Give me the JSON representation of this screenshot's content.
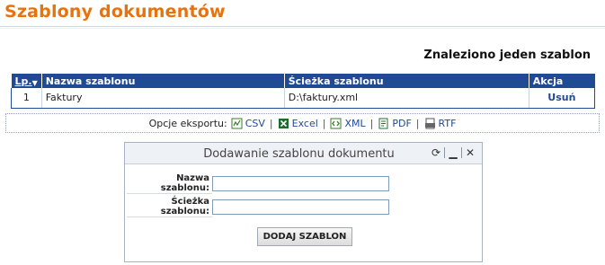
{
  "page": {
    "title": "Szablony dokumentów"
  },
  "results": {
    "found_text": "Znaleziono jeden szablon"
  },
  "table": {
    "columns": [
      "Lp.",
      "Nazwa szablonu",
      "Ścieżka szablonu",
      "Akcja"
    ],
    "rows": [
      {
        "lp": "1",
        "name": "Faktury",
        "path": "D:\\faktury.xml",
        "action": "Usuń"
      }
    ]
  },
  "export": {
    "label": "Opcje eksportu:",
    "formats": [
      "CSV",
      "Excel",
      "XML",
      "PDF",
      "RTF"
    ],
    "separator": "|"
  },
  "dialog": {
    "title": "Dodawanie szablonu dokumentu",
    "fields": [
      {
        "label": "Nazwa szablonu:",
        "value": ""
      },
      {
        "label": "Ścieżka szablonu:",
        "value": ""
      }
    ],
    "submit_label": "DODAJ SZABLON"
  },
  "colors": {
    "accent": "#e8730c",
    "header_bg": "#1f4a94",
    "link": "#1f4a94"
  },
  "icons": [
    "refresh-icon",
    "minimize-icon",
    "close-icon",
    "csv-icon",
    "excel-icon",
    "xml-icon",
    "pdf-icon",
    "rtf-icon",
    "sort-arrow-icon"
  ]
}
